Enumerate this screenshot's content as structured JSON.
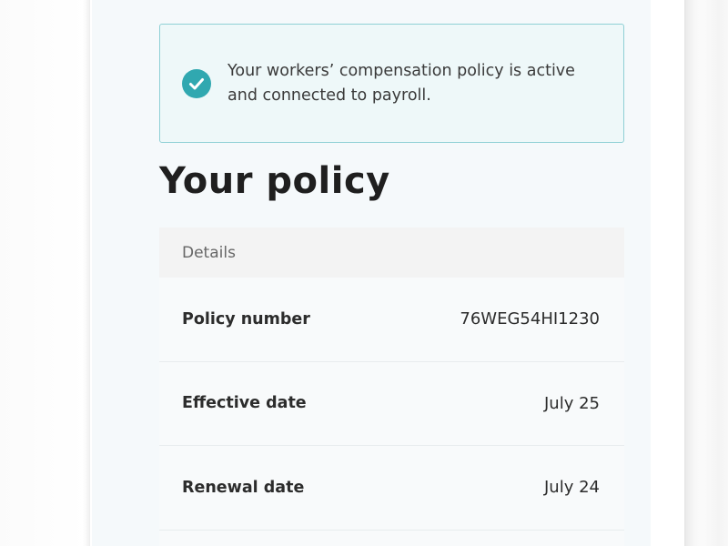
{
  "alert": {
    "message": "Your workers’ compensation policy is active and connected to payroll.",
    "icon": "check-circle-icon",
    "accent_color": "#30a8b0"
  },
  "page_title": "Your policy",
  "details": {
    "header": "Details",
    "rows": [
      {
        "label": "Policy number",
        "value": "76WEG54HI1230"
      },
      {
        "label": "Effective date",
        "value": "July 25"
      },
      {
        "label": "Renewal date",
        "value": "July 24"
      }
    ]
  }
}
